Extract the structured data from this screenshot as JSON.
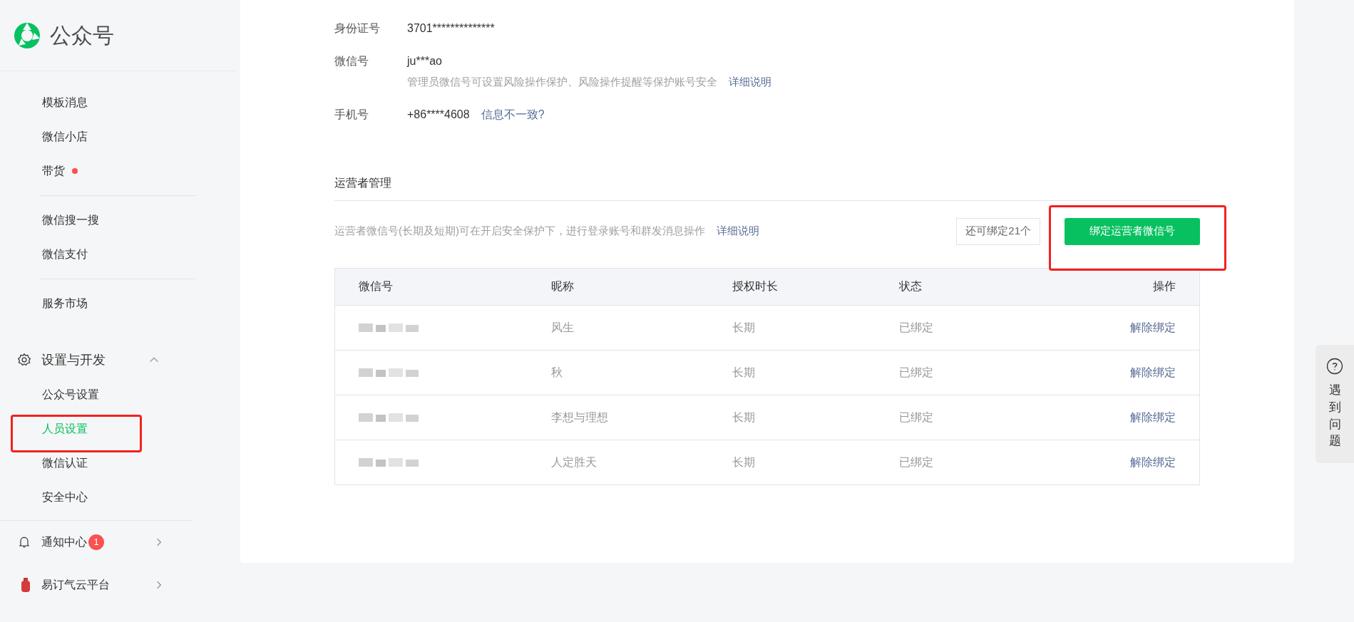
{
  "logo": {
    "title": "公众号"
  },
  "sidebar": {
    "items": [
      {
        "label": "模板消息",
        "selected": false,
        "dot": false
      },
      {
        "label": "微信小店",
        "selected": false,
        "dot": false
      },
      {
        "label": "带货",
        "selected": false,
        "dot": true
      },
      {
        "kind": "divider"
      },
      {
        "label": "微信搜一搜",
        "selected": false,
        "dot": false
      },
      {
        "label": "微信支付",
        "selected": false,
        "dot": false
      },
      {
        "kind": "divider"
      },
      {
        "label": "服务市场",
        "selected": false,
        "dot": false
      }
    ],
    "section": {
      "label": "设置与开发",
      "expanded": true,
      "children": [
        {
          "label": "公众号设置",
          "selected": false
        },
        {
          "label": "人员设置",
          "selected": true
        },
        {
          "label": "微信认证",
          "selected": false
        },
        {
          "label": "安全中心",
          "selected": false
        }
      ]
    },
    "bottom": [
      {
        "kind": "bell",
        "label": "通知中心",
        "badge": "1"
      },
      {
        "kind": "app",
        "label": "易订气云平台"
      }
    ]
  },
  "admin": {
    "fields": [
      {
        "label": "身份证号",
        "value": "3701**************"
      },
      {
        "label": "微信号",
        "value": "ju***ao",
        "hint": "管理员微信号可设置风险操作保护、风险操作提醒等保护账号安全",
        "link": "详细说明"
      },
      {
        "label": "手机号",
        "value": "+86****4608",
        "link": "信息不一致?"
      }
    ]
  },
  "operators": {
    "title": "运营者管理",
    "description": "运营者微信号(长期及短期)可在开启安全保护下，进行登录账号和群发消息操作",
    "link": "详细说明",
    "remaining": "还可绑定21个",
    "bind_button": "绑定运营者微信号",
    "table": {
      "columns": [
        "微信号",
        "昵称",
        "授权时长",
        "状态",
        "操作"
      ],
      "rows": [
        {
          "nickname": "风生",
          "duration": "长期",
          "status": "已绑定",
          "action": "解除绑定"
        },
        {
          "nickname": "秋",
          "duration": "长期",
          "status": "已绑定",
          "action": "解除绑定"
        },
        {
          "nickname": "李想与理想",
          "duration": "长期",
          "status": "已绑定",
          "action": "解除绑定"
        },
        {
          "nickname": "人定胜天",
          "duration": "长期",
          "status": "已绑定",
          "action": "解除绑定"
        }
      ]
    }
  },
  "help_tab": {
    "label": "遇到问题"
  }
}
